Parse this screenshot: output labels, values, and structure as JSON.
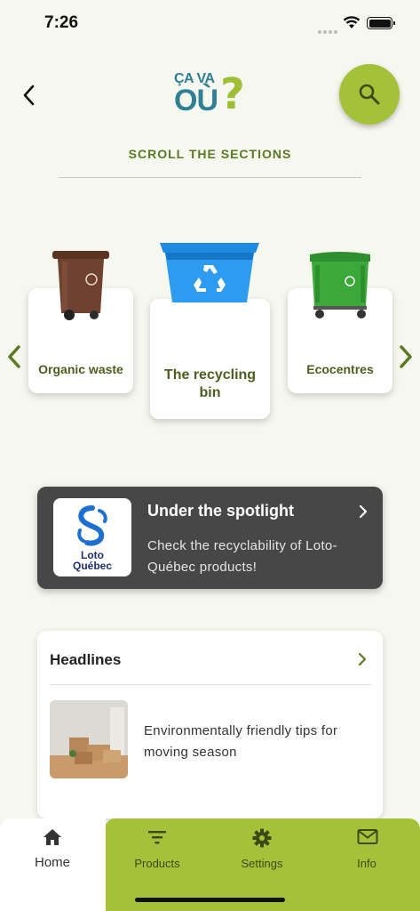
{
  "status_bar": {
    "time": "7:26"
  },
  "header": {
    "logo_top": "ÇA VA",
    "logo_main": "OÙ",
    "logo_mark": "?",
    "icons": {
      "back": "chevron-left-icon",
      "search": "search-icon"
    },
    "accent_color": "#a3c239"
  },
  "section": {
    "title": "SCROLL THE SECTIONS"
  },
  "carousel": {
    "items": [
      {
        "label": "Organic waste",
        "icon": "brown-bin-icon"
      },
      {
        "label": "The recycling bin",
        "icon": "blue-recycling-bin-icon"
      },
      {
        "label": "Ecocentres",
        "icon": "green-dumpster-icon"
      }
    ],
    "arrow_color": "#5a7a22"
  },
  "spotlight": {
    "title": "Under the spotlight",
    "description": "Check the recyclability of Loto-Québec products!",
    "logo_line1": "Loto",
    "logo_line2": "Québec",
    "background": "#474747"
  },
  "headlines": {
    "title": "Headlines",
    "items": [
      {
        "text": "Environmentally friendly tips for moving season"
      }
    ]
  },
  "tab_bar": {
    "tabs": [
      {
        "label": "Home",
        "icon": "home-icon",
        "active": true
      },
      {
        "label": "Products",
        "icon": "filter-icon",
        "active": false
      },
      {
        "label": "Settings",
        "icon": "gear-icon",
        "active": false
      },
      {
        "label": "Info",
        "icon": "mail-icon",
        "active": false
      }
    ]
  }
}
